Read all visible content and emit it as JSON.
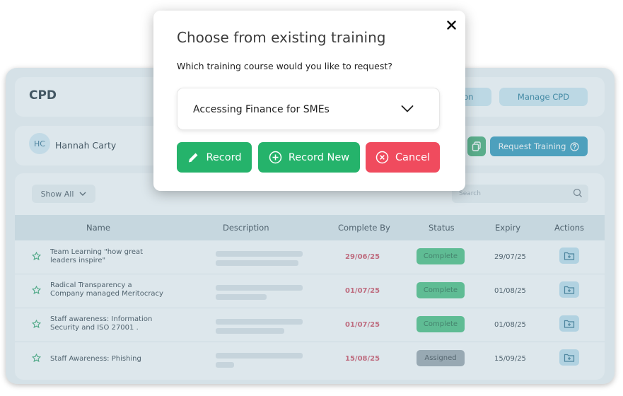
{
  "app": {
    "title": "CPD",
    "top_buttons": {
      "partial_label": "ation",
      "manage_label": "Manage CPD"
    },
    "user": {
      "initials": "HC",
      "name": "Hannah Carty"
    },
    "request_training_label": "Request Training",
    "filter": {
      "label": "Show All"
    },
    "search": {
      "placeholder": "Search"
    },
    "columns": {
      "name": "Name",
      "description": "Description",
      "complete_by": "Complete By",
      "status": "Status",
      "expiry": "Expiry",
      "actions": "Actions"
    },
    "rows": [
      {
        "name": "Team Learning \"how great leaders inspire\"",
        "complete_by": "29/06/25",
        "status": "Complete",
        "expiry": "29/07/25"
      },
      {
        "name": "Radical Transparency a Company managed Meritocracy",
        "complete_by": "01/07/25",
        "status": "Complete",
        "expiry": "01/08/25"
      },
      {
        "name": "Staff awareness: Information Security and ISO 27001 .",
        "complete_by": "01/07/25",
        "status": "Complete",
        "expiry": "01/08/25"
      },
      {
        "name": "Staff Awareness: Phishing",
        "complete_by": "15/08/25",
        "status": "Assigned",
        "expiry": "15/09/25"
      }
    ]
  },
  "modal": {
    "title": "Choose from existing training",
    "question": "Which training course would you like to request?",
    "selected_course": "Accessing Finance for SMEs",
    "buttons": {
      "record": "Record",
      "record_new": "Record New",
      "cancel": "Cancel"
    }
  },
  "colors": {
    "green": "#25b36b",
    "red": "#f04b5e",
    "blue": "#2b97ba",
    "light_blue": "#cfe9f4"
  }
}
